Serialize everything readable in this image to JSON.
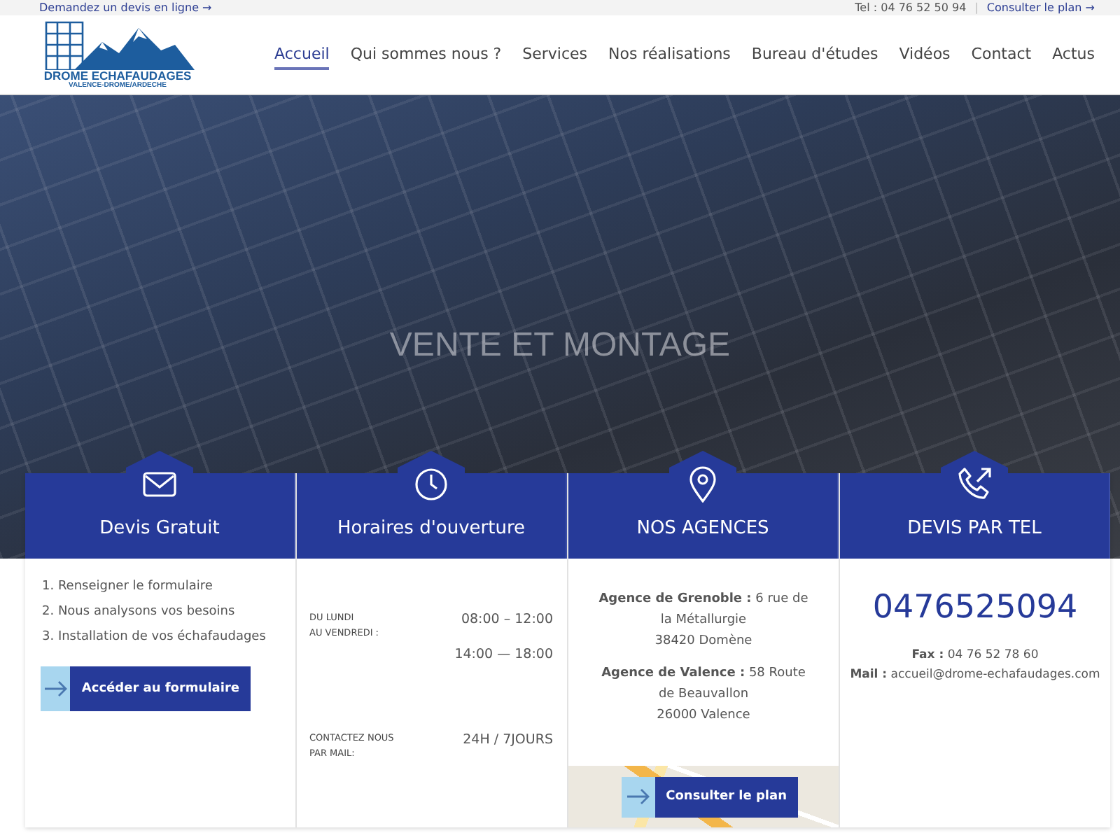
{
  "top_bar": {
    "left_link": "Demandez un devis en ligne →",
    "phone": "Tel : 04 76 52 50 94",
    "separator": "|",
    "right_link": "Consulter le plan →"
  },
  "logo": {
    "name": "DROME ECHAFAUDAGES",
    "tagline": "VALENCE-DROME/ARDECHE"
  },
  "nav": [
    {
      "label": "Accueil",
      "selected": true
    },
    {
      "label": "Qui sommes nous ?",
      "selected": false
    },
    {
      "label": "Services",
      "selected": false
    },
    {
      "label": "Nos réalisations",
      "selected": false
    },
    {
      "label": "Bureau d'études",
      "selected": false
    },
    {
      "label": "Vidéos",
      "selected": false
    },
    {
      "label": "Contact",
      "selected": false
    },
    {
      "label": "Actus",
      "selected": false
    }
  ],
  "hero": {
    "title": "VENTE ET MONTAGE"
  },
  "cards": [
    {
      "kind": "steps",
      "title": "Devis Gratuit",
      "steps": [
        "1. Renseigner le formulaire",
        "2. Nous analysons vos besoins",
        "3. Installation de vos échafaudages"
      ],
      "button": "Accéder au formulaire"
    },
    {
      "kind": "hours",
      "title": "Horaires d'ouverture",
      "rows": [
        {
          "label": [
            "DU LUNDI",
            "AU VENDREDI :"
          ],
          "values": [
            "08:00 – 12:00",
            "14:00 — 18:00"
          ]
        },
        {
          "label": [
            "CONTACTEZ NOUS",
            "PAR MAIL:"
          ],
          "values": [
            "24H / 7JOURS"
          ]
        }
      ]
    },
    {
      "kind": "agencies",
      "title": "NOS AGENCES",
      "agencies": [
        {
          "lines": [
            "**Agence de Grenoble :** 6 rue de la Métallurgie",
            "38420 Domène"
          ]
        },
        {
          "lines": [
            "**Agence de Valence :** 58 Route de Beauvallon",
            "26000 Valence"
          ]
        }
      ],
      "button": "Consulter le plan"
    },
    {
      "kind": "phone",
      "title": "DEVIS PAR TEL",
      "number": "0476525094",
      "lines": [
        "**Fax :** 04 76 52 78 60",
        "**Mail :** accueil@drome-echafaudages.com"
      ]
    }
  ]
}
